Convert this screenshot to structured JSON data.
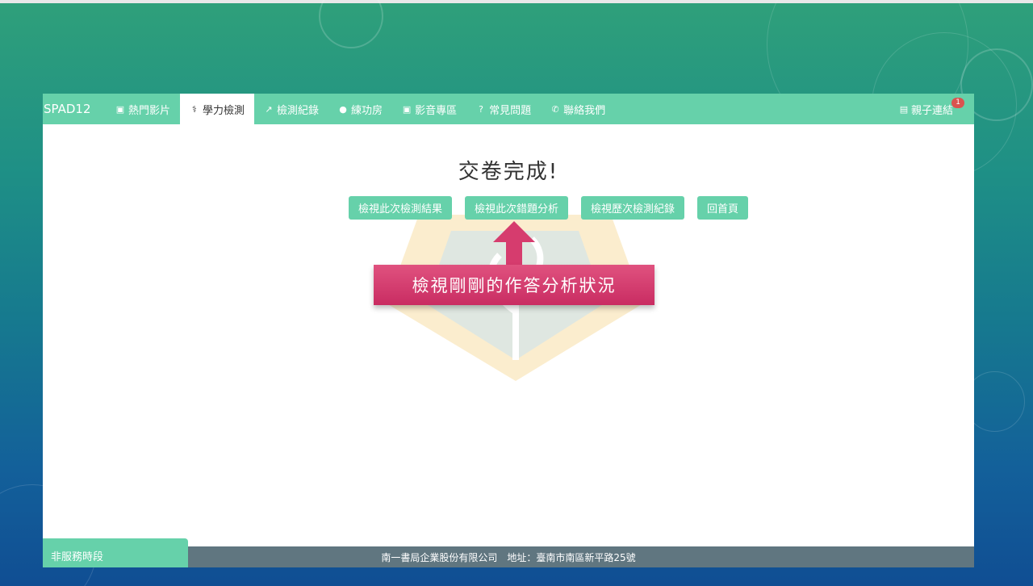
{
  "navbar": {
    "brand": "SPAD12",
    "items": [
      {
        "label": "熱門影片",
        "icon": "play-square-icon",
        "active": false
      },
      {
        "label": "學力檢測",
        "icon": "stethoscope-icon",
        "active": true
      },
      {
        "label": "檢測紀錄",
        "icon": "line-chart-icon",
        "active": false
      },
      {
        "label": "練功房",
        "icon": "user-icon",
        "active": false
      },
      {
        "label": "影音專區",
        "icon": "play-square-icon",
        "active": false
      },
      {
        "label": "常見問題",
        "icon": "question-icon",
        "active": false
      },
      {
        "label": "聯絡我們",
        "icon": "phone-icon",
        "active": false
      }
    ],
    "right_link": {
      "label": "親子連結",
      "icon": "contact-card-icon",
      "badge": "1"
    }
  },
  "main": {
    "heading": "交卷完成!",
    "buttons": [
      {
        "label": "檢視此次檢測結果"
      },
      {
        "label": "檢視此次錯題分析"
      },
      {
        "label": "檢視歷次檢測紀錄"
      },
      {
        "label": "回首頁"
      }
    ]
  },
  "annotation": {
    "callout": "檢視剛剛的作答分析狀況",
    "color": "#d63c6e"
  },
  "footer": {
    "company": "南一書局企業股份有限公司",
    "address": "地址：臺南市南區新平路25號",
    "service_tab": "非服務時段"
  },
  "colors": {
    "accent": "#66d1aa",
    "footer": "#607680",
    "badge": "#d9534f"
  }
}
